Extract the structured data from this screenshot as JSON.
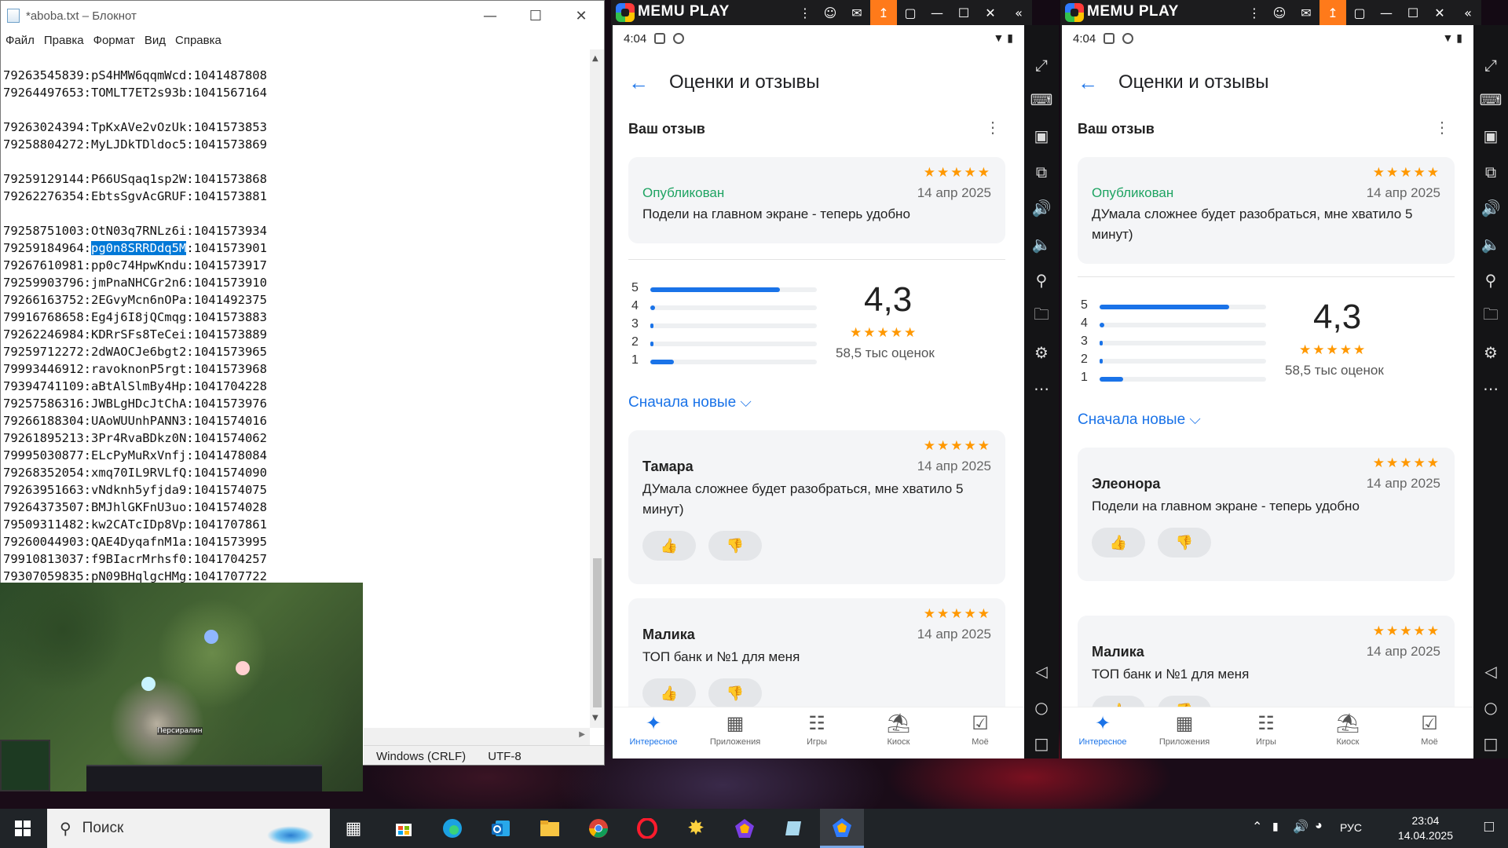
{
  "notepad": {
    "title": "*aboba.txt – Блокнот",
    "menu": [
      "Файл",
      "Правка",
      "Формат",
      "Вид",
      "Справка"
    ],
    "lines": [
      "79263545839:pS4HMW6qqmWcd:1041487808",
      "79264497653:TOMLT7ET2s93b:1041567164",
      "",
      "79263024394:TpKxAVe2vOzUk:1041573853",
      "79258804272:MyLJDkTDldoc5:1041573869",
      "",
      "79259129144:P66USqaq1sp2W:1041573868",
      "79262276354:EbtsSgvAcGRUF:1041573881",
      "",
      "79258751003:OtN03q7RNLz6i:1041573934",
      "79259184964:pg0n8SRRDdq5M:1041573901",
      "79267610981:pp0c74HpwKndu:1041573917",
      "79259903796:jmPnaNHCGr2n6:1041573910",
      "79266163752:2EGvyMcn6nOPa:1041492375",
      "79916768658:Eg4j6I8jQCmqg:1041573883",
      "79262246984:KDRrSFs8TeCei:1041573889",
      "79259712272:2dWAOCJe6bgt2:1041573965",
      "79993446912:ravoknonP5rgt:1041573968",
      "79394741109:aBtAlSlmBy4Hp:1041704228",
      "79257586316:JWBLgHDcJtChA:1041573976",
      "79266188304:UAoWUUnhPANN3:1041574016",
      "79261895213:3Pr4RvaBDkz0N:1041574062",
      "79995030877:ELcPyMuRxVnfj:1041478084",
      "79268352054:xmq70IL9RVLfQ:1041574090",
      "79263951663:vNdknh5yfjda9:1041574075",
      "79264373507:BMJhlGKFnU3uo:1041574028",
      "79509311482:kw2CATcIDp8Vp:1041707861",
      "79260044903:QAE4DyqafnM1a:1041573995",
      "79910813037:f9BIacrMrhsf0:1041704257",
      "79307059835:pN09BHqlgcHMg:1041707722"
    ],
    "selected_line_index": 10,
    "selected_prefix": "79259184964:",
    "selected_text": "pg0n8SRRDdq5M",
    "selected_suffix": ":1041573901",
    "status": {
      "eol": "Windows (CRLF)",
      "encoding": "UTF-8"
    }
  },
  "game_overlay": {
    "label": "Персиралин"
  },
  "memu_windows": [
    {
      "brand": "MEMU PLAY",
      "time": "4:04",
      "header_title": "Оценки и отзывы",
      "your_review_label": "Ваш отзыв",
      "my_review": {
        "status": "Опубликован",
        "date": "14 апр 2025",
        "text": "Подели на главном экране - теперь удобно",
        "stars": "★★★★★"
      },
      "rating": {
        "value": "4,3",
        "count": "58,5 тыс оценок",
        "stars": "★★★★★",
        "distribution": [
          {
            "label": "5",
            "fraction": 0.78
          },
          {
            "label": "4",
            "fraction": 0.03
          },
          {
            "label": "3",
            "fraction": 0.02
          },
          {
            "label": "2",
            "fraction": 0.02
          },
          {
            "label": "1",
            "fraction": 0.14
          }
        ]
      },
      "sort_label": "Сначала новые ⌵",
      "reviews": [
        {
          "name": "Тамара",
          "date": "14 апр 2025",
          "text": "ДУмала сложнее будет разобраться, мне хватило 5 минут)",
          "stars": "★★★★★"
        },
        {
          "name": "Малика",
          "date": "14 апр 2025",
          "text": "ТОП банк и №1 для меня",
          "stars": "★★★★★"
        }
      ],
      "nav": [
        "Интересное",
        "Приложения",
        "Игры",
        "Киоск",
        "Моё"
      ]
    },
    {
      "brand": "MEMU PLAY",
      "time": "4:04",
      "header_title": "Оценки и отзывы",
      "your_review_label": "Ваш отзыв",
      "my_review": {
        "status": "Опубликован",
        "date": "14 апр 2025",
        "text": "ДУмала сложнее будет разобраться, мне хватило 5 минут)",
        "stars": "★★★★★"
      },
      "rating": {
        "value": "4,3",
        "count": "58,5 тыс оценок",
        "stars": "★★★★★",
        "distribution": [
          {
            "label": "5",
            "fraction": 0.78
          },
          {
            "label": "4",
            "fraction": 0.03
          },
          {
            "label": "3",
            "fraction": 0.02
          },
          {
            "label": "2",
            "fraction": 0.02
          },
          {
            "label": "1",
            "fraction": 0.14
          }
        ]
      },
      "sort_label": "Сначала новые ⌵",
      "reviews": [
        {
          "name": "Элеонора",
          "date": "14 апр 2025",
          "text": "Подели на главном экране - теперь удобно",
          "stars": "★★★★★"
        },
        {
          "name": "Малика",
          "date": "14 апр 2025",
          "text": "ТОП банк и №1 для меня",
          "stars": "★★★★★"
        }
      ],
      "nav": [
        "Интересное",
        "Приложения",
        "Игры",
        "Киоск",
        "Моё"
      ]
    }
  ],
  "taskbar": {
    "search_placeholder": "Поиск",
    "language": "РУС",
    "time": "23:04",
    "date": "14.04.2025"
  },
  "colors": {
    "accent": "#1a73e8",
    "star": "#ff9800",
    "published": "#1ea362",
    "memu_upload": "#ff7a1a"
  }
}
